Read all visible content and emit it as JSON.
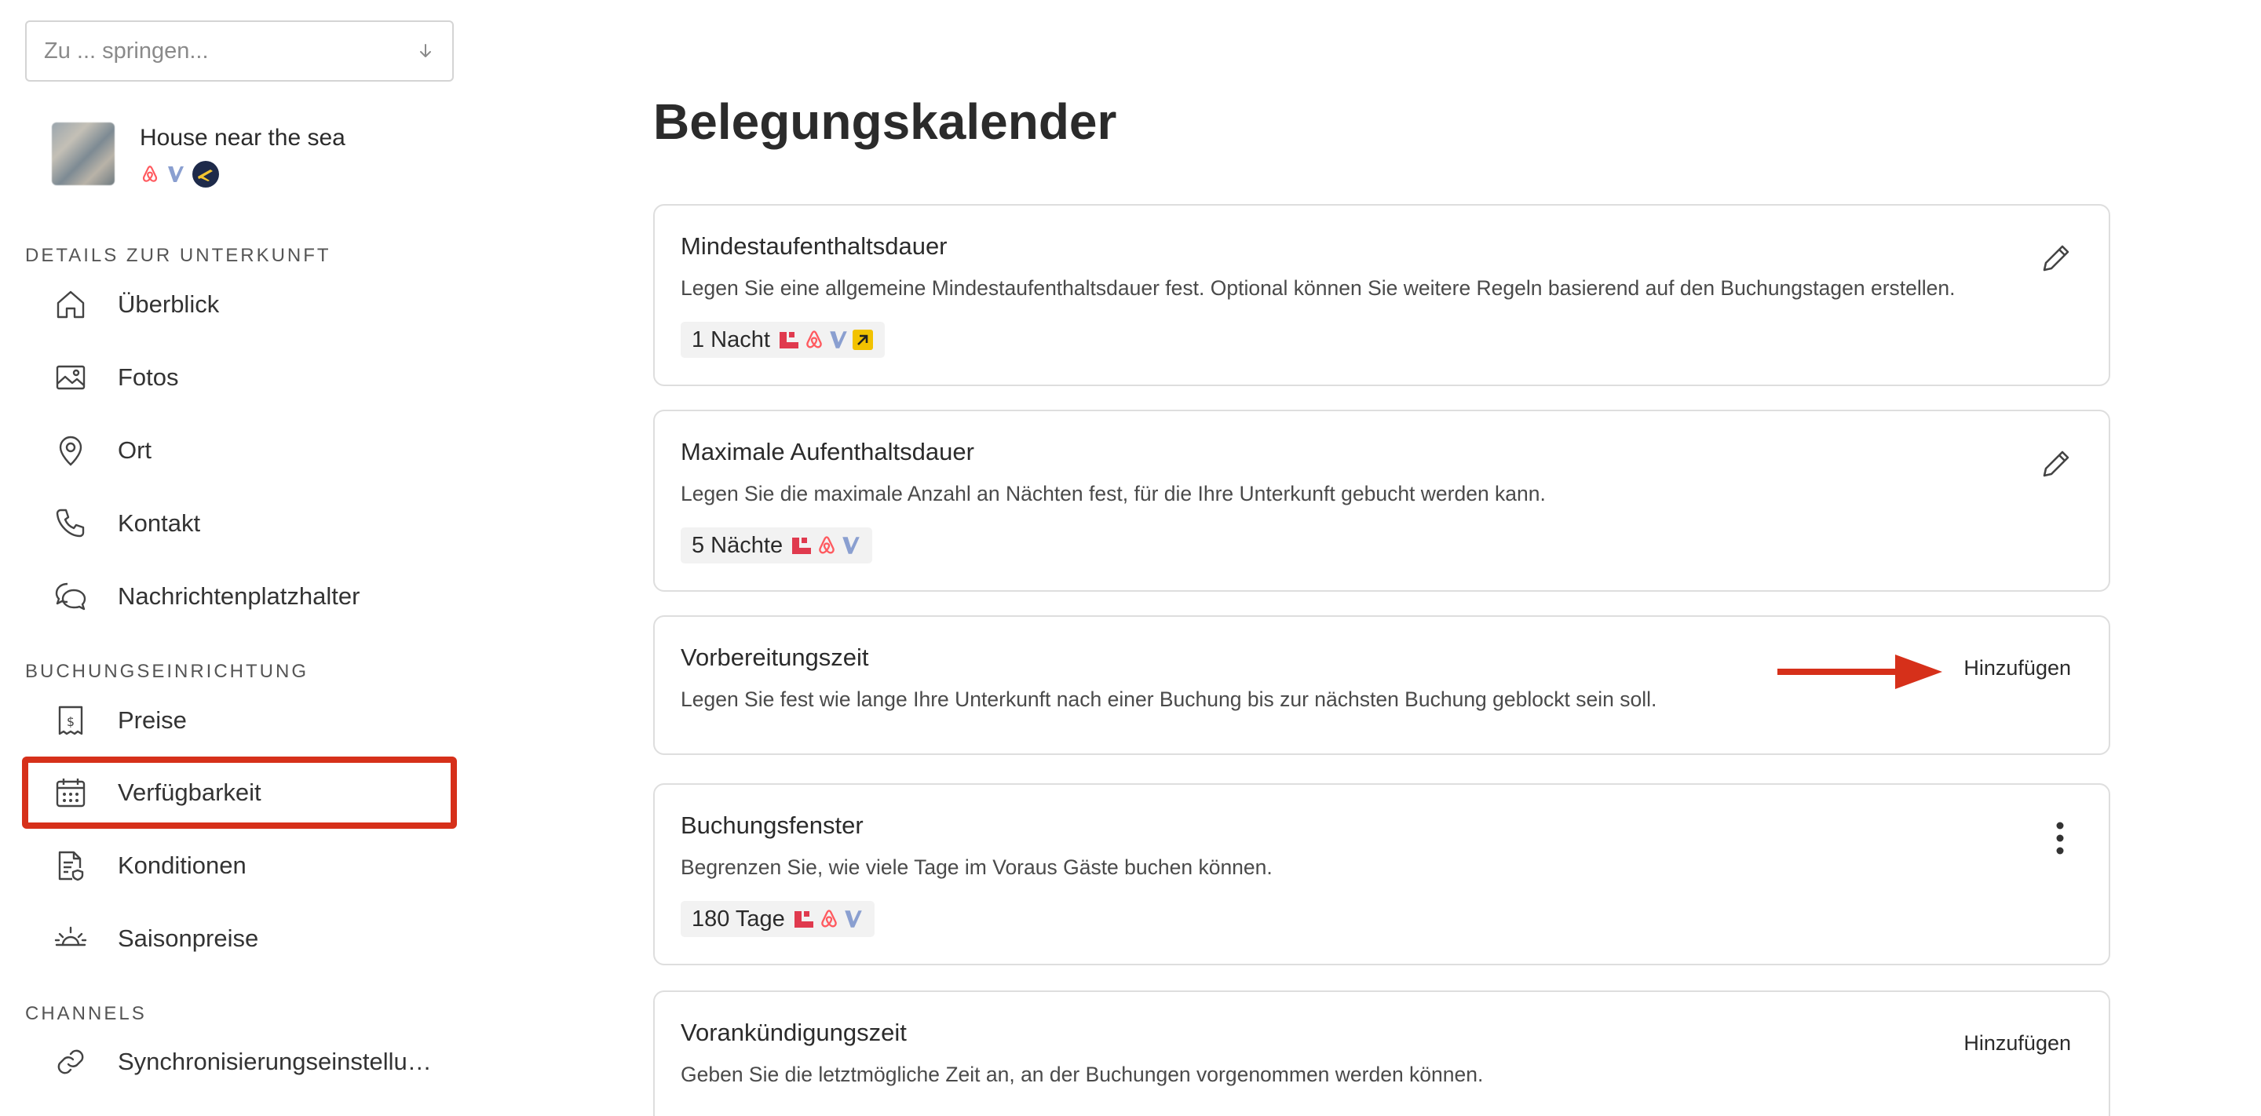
{
  "jump": {
    "placeholder": "Zu ... springen..."
  },
  "property": {
    "name": "House near the sea",
    "channels": [
      "airbnb-icon",
      "vrbo-icon",
      "expedia-icon"
    ]
  },
  "sidebar": {
    "sections": [
      {
        "heading": "DETAILS ZUR UNTERKUNFT",
        "items": [
          "Überblick",
          "Fotos",
          "Ort",
          "Kontakt",
          "Nachrichtenplatzhalter"
        ]
      },
      {
        "heading": "BUCHUNGSEINRICHTUNG",
        "items": [
          "Preise",
          "Verfügbarkeit",
          "Konditionen",
          "Saisonpreise"
        ]
      },
      {
        "heading": "CHANNELS",
        "items": [
          "Synchronisierungseinstellu…"
        ]
      }
    ],
    "active_item": "Verfügbarkeit"
  },
  "main": {
    "title": "Belegungskalender",
    "cards": [
      {
        "title": "Mindestaufenthaltsdauer",
        "desc": "Legen Sie eine allgemeine Mindestaufenthaltsdauer fest. Optional können Sie weitere Regeln basierend auf den Buchungstagen erstellen.",
        "chip": "1 Nacht",
        "action": "edit"
      },
      {
        "title": "Maximale Aufenthaltsdauer",
        "desc": "Legen Sie die maximale Anzahl an Nächten fest, für die Ihre Unterkunft gebucht werden kann.",
        "chip": "5 Nächte",
        "action": "edit"
      },
      {
        "title": "Vorbereitungszeit",
        "desc": "Legen Sie fest wie lange Ihre Unterkunft nach einer Buchung bis zur nächsten Buchung geblockt sein soll.",
        "action": "Hinzufügen"
      },
      {
        "title": "Buchungsfenster",
        "desc": "Begrenzen Sie, wie viele Tage im Voraus Gäste buchen können.",
        "chip": "180 Tage",
        "action": "menu"
      },
      {
        "title": "Vorankündigungszeit",
        "desc": "Geben Sie die letztmögliche Zeit an, an der Buchungen vorgenommen werden können.",
        "action": "Hinzufügen"
      }
    ]
  },
  "colors": {
    "accent_red": "#d6301a",
    "smoobu_red": "#e03a4e",
    "airbnb": "#ff5a5f",
    "vrbo": "#8a9fd0",
    "booking_yellow": "#f2c200"
  }
}
